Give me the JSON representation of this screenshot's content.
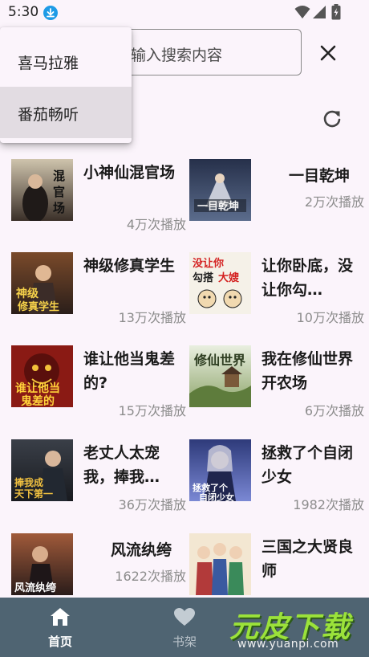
{
  "status_bar": {
    "time": "5:30"
  },
  "search": {
    "placeholder": "输入搜索内容"
  },
  "dropdown": {
    "items": [
      {
        "label": "喜马拉雅"
      },
      {
        "label": "番茄畅听"
      }
    ],
    "selected": "番茄畅听"
  },
  "books": [
    {
      "title": "小神仙混官场",
      "plays": "4万次播放",
      "cover_text": "小神仙混官场"
    },
    {
      "title": "一目乾坤",
      "plays": "2万次播放",
      "cover_text": "一目乾坤"
    },
    {
      "title": "神级修真学生",
      "plays": "13万次播放",
      "cover_text": "神级修真学生"
    },
    {
      "title": "让你卧底，没让你勾…",
      "plays": "10万次播放",
      "cover_text": "没让你勾搭大嫂"
    },
    {
      "title": "谁让他当鬼差的?",
      "plays": "15万次播放",
      "cover_text": "谁让他当鬼差的"
    },
    {
      "title": "我在修仙世界开农场",
      "plays": "6万次播放",
      "cover_text": "修仙世界"
    },
    {
      "title": "老丈人太宠我，捧我…",
      "plays": "36万次播放",
      "cover_text": "捧我成天下第一"
    },
    {
      "title": "拯救了个自闭少女",
      "plays": "1982次播放",
      "cover_text": "拯救了个自闭少女"
    },
    {
      "title": "风流纨绔",
      "plays": "1622次播放",
      "cover_text": "风流纨绔"
    },
    {
      "title": "三国之大贤良师",
      "plays": "",
      "cover_text": ""
    }
  ],
  "bottom_nav": {
    "home_label": "首页",
    "shelf_label": "书架"
  },
  "watermark": {
    "text": "元皮下载",
    "url": "www.yuanpi.com"
  },
  "colors": {
    "background": "#FBF4FB",
    "nav_bar": "#4F6472",
    "download_icon": "#1E9BE6",
    "watermark_green": "#9BE23A"
  }
}
